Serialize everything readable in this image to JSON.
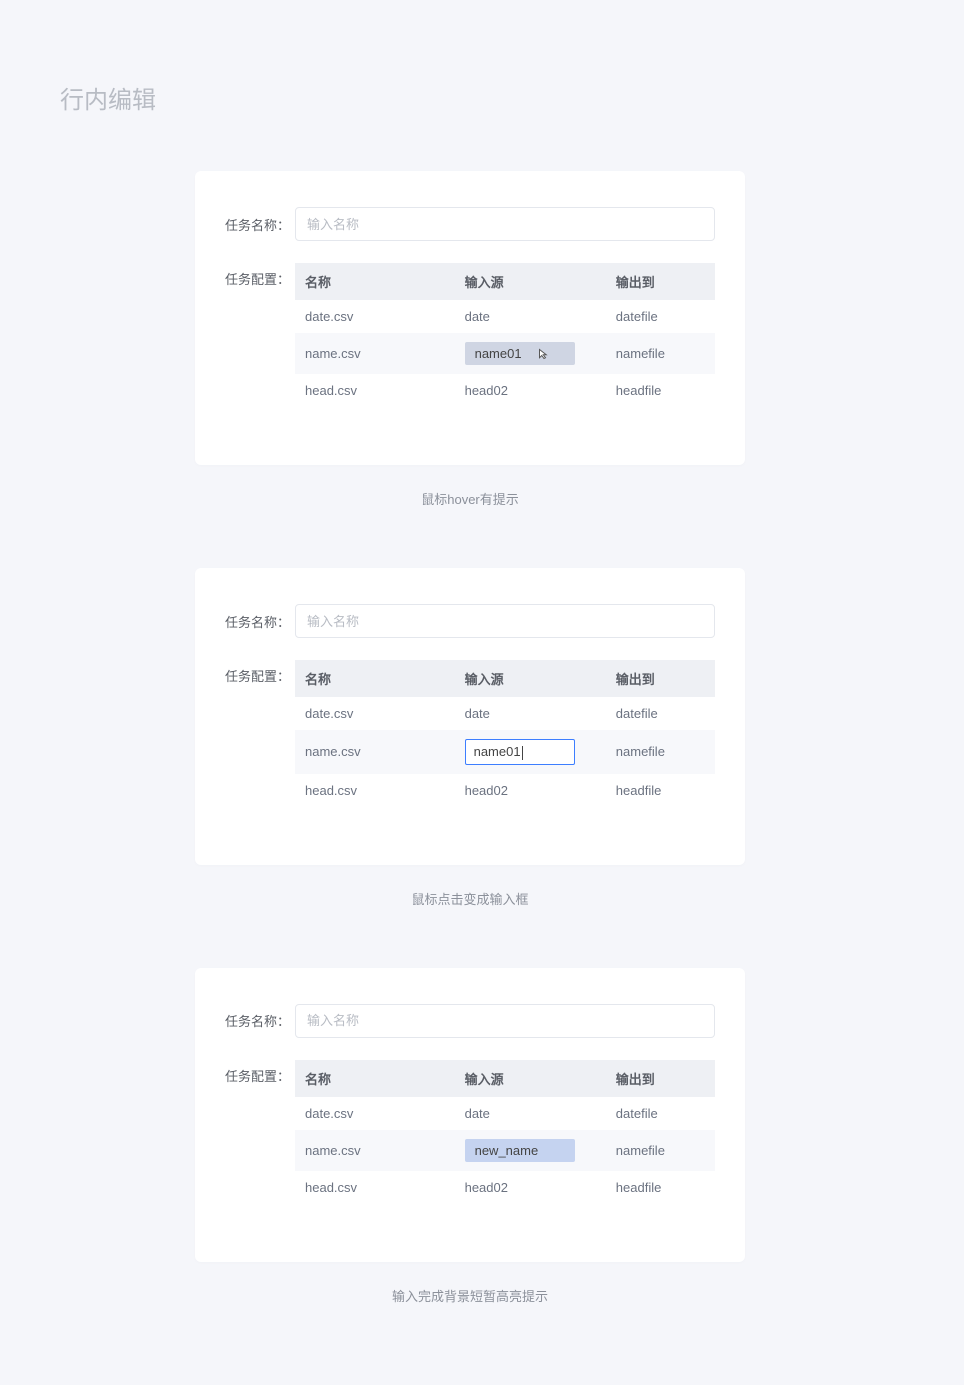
{
  "page_title": "行内编辑",
  "labels": {
    "task_name": "任务名称：",
    "task_config": "任务配置：",
    "name_placeholder": "输入名称"
  },
  "table": {
    "headers": {
      "name": "名称",
      "source": "输入源",
      "output": "输出到"
    },
    "rows": [
      {
        "name": "date.csv",
        "source": "date",
        "output": "datefile"
      },
      {
        "name": "name.csv",
        "source": "name01",
        "output": "namefile"
      },
      {
        "name": "head.csv",
        "source": "head02",
        "output": "headfile"
      }
    ]
  },
  "section1": {
    "hover_cell_value": "name01",
    "caption": "鼠标hover有提示"
  },
  "section2": {
    "editing_value": "name01",
    "caption": "鼠标点击变成输入框"
  },
  "section3": {
    "new_value": "new_name",
    "caption": "输入完成背景短暂高亮提示"
  }
}
